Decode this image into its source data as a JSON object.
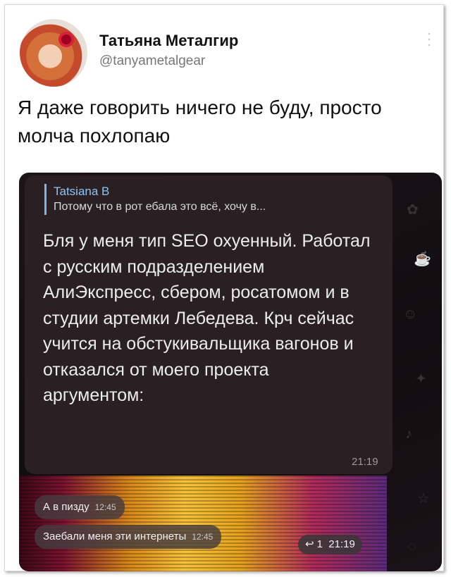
{
  "tweet": {
    "author_name": "Татьяна Металгир",
    "author_handle": "@tanyametalgear",
    "text": "Я даже говорить ничего не буду, просто молча похлопаю"
  },
  "chat": {
    "reply_author": "Tatsiana B",
    "reply_snippet": "Потому что в рот ебала это всё, хочу в...",
    "message": "Бля у меня тип SEO охуенный. Работал с русским подразделением АлиЭкспресс, сбером, росатомом и в студии артемки Лебедева. Крч сейчас учится на обстукивальщика вагонов и отказался от моего проекта аргументом:",
    "message_time": "21:19",
    "attachment": {
      "bubbles": [
        {
          "text": "А в пизду",
          "time": "12:45"
        },
        {
          "text": "Заебали меня эти интернеты",
          "time": "12:45"
        }
      ],
      "reply_count": "1",
      "time": "21:19"
    }
  },
  "colors": {
    "link_blue": "#8ec2f2",
    "bubble_bg": "#2a2024",
    "chat_bg": "#1a1216"
  }
}
